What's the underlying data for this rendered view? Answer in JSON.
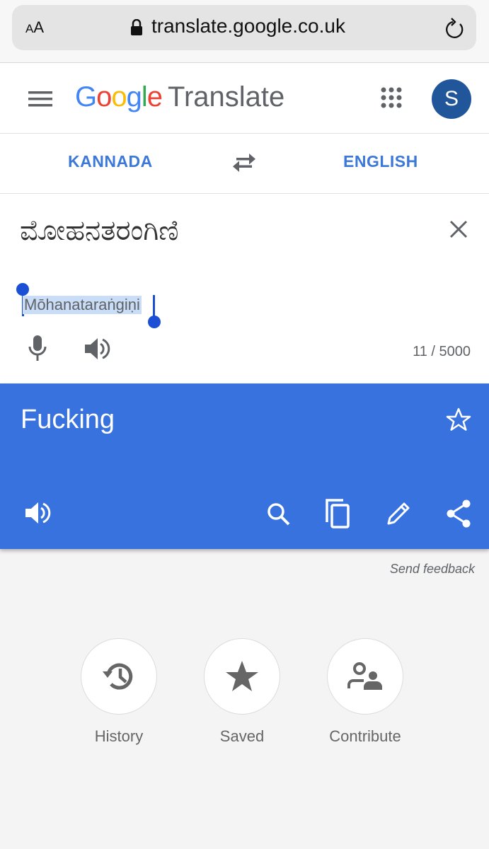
{
  "browser": {
    "text_size_label_small": "A",
    "text_size_label_large": "A",
    "url": "translate.google.co.uk"
  },
  "appbar": {
    "logo_letters": [
      "G",
      "o",
      "o",
      "g",
      "l",
      "e"
    ],
    "product_name": "Translate",
    "avatar_initial": "S"
  },
  "languages": {
    "source": "KANNADA",
    "target": "ENGLISH"
  },
  "input": {
    "source_text": "ಮೋಹನತರಂಗಿಣಿ",
    "transliteration": "Mōhanataraṅgiṇi",
    "char_count": "11 / 5000"
  },
  "result": {
    "translation": "Fucking",
    "background_color": "#3872df"
  },
  "feedback_label": "Send feedback",
  "shortcuts": [
    {
      "label": "History",
      "icon": "history-icon"
    },
    {
      "label": "Saved",
      "icon": "star-icon"
    },
    {
      "label": "Contribute",
      "icon": "contribute-icon"
    }
  ]
}
